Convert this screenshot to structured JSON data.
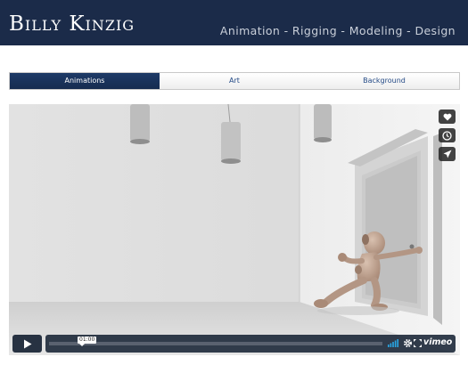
{
  "header": {
    "title": "Billy Kinzig",
    "tagline": "Animation - Rigging - Modeling - Design"
  },
  "tabs": [
    {
      "label": "Animations",
      "active": true
    },
    {
      "label": "Art",
      "active": false
    },
    {
      "label": "Background",
      "active": false
    }
  ],
  "player": {
    "time": "01:00",
    "logo": "vimeo",
    "side_icons": [
      "heart-icon",
      "clock-icon",
      "send-icon"
    ],
    "control_icons": [
      "play-icon",
      "volume-icon",
      "gear-icon",
      "fullscreen-icon"
    ]
  },
  "colors": {
    "header_bg": "#1b2b49",
    "tab_active_bg": "#1d3a67",
    "tab_text": "#244a86",
    "player_controls_bg": "#172334"
  }
}
